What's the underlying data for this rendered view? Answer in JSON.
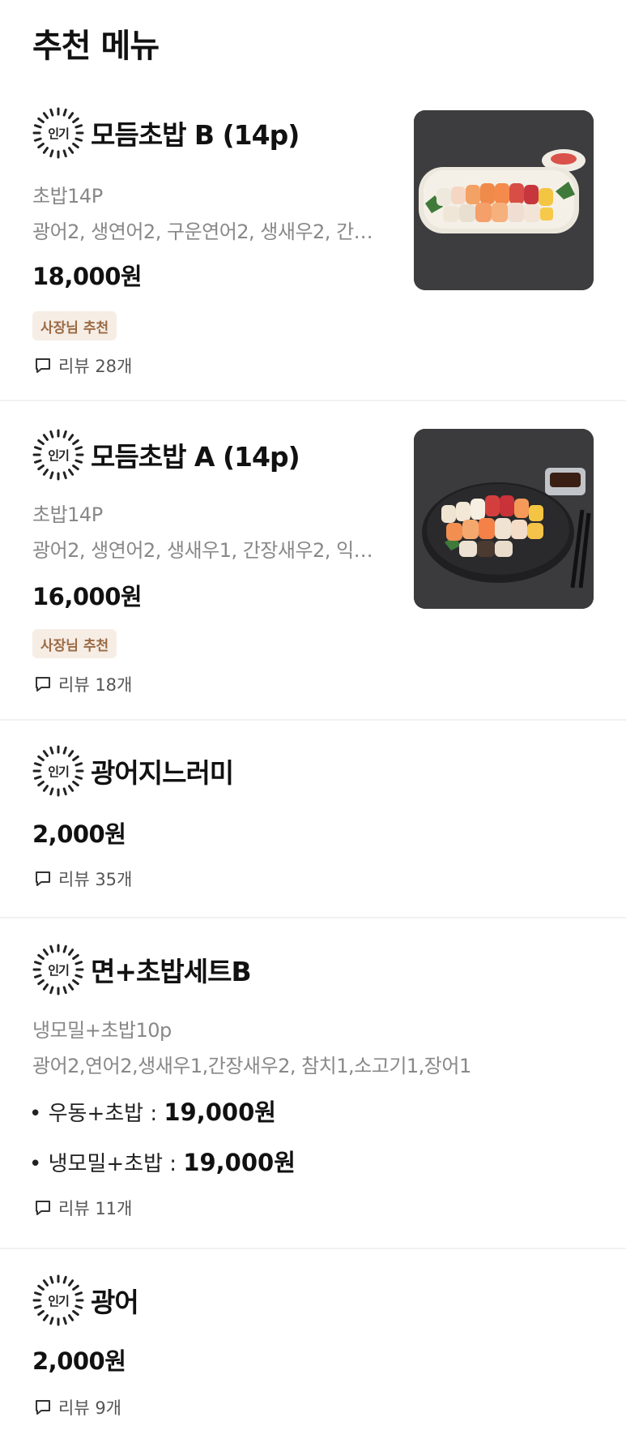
{
  "section_title": "추천 메뉴",
  "popular_badge": "인기",
  "items": [
    {
      "name": "모듬초밥 B (14p)",
      "sub": "초밥14P",
      "desc": "광어2, 생연어2, 구운연어2, 생새우2, 간…",
      "price": "18,000원",
      "owner_badge": "사장님 추천",
      "review": "리뷰 28개"
    },
    {
      "name": "모듬초밥 A (14p)",
      "sub": "초밥14P",
      "desc": "광어2, 생연어2, 생새우1, 간장새우2, 익…",
      "price": "16,000원",
      "owner_badge": "사장님 추천",
      "review": "리뷰 18개"
    },
    {
      "name": "광어지느러미",
      "price": "2,000원",
      "review": "리뷰 35개"
    },
    {
      "name": "면+초밥세트B",
      "sub": "냉모밀+초밥10p",
      "desc": "광어2,연어2,생새우1,간장새우2, 참치1,소고기1,장어1",
      "options": [
        {
          "label": "• 우동+초밥 : ",
          "price": "19,000원"
        },
        {
          "label": "• 냉모밀+초밥 : ",
          "price": "19,000원"
        }
      ],
      "review": "리뷰 11개"
    },
    {
      "name": "광어",
      "price": "2,000원",
      "review": "리뷰 9개"
    }
  ]
}
